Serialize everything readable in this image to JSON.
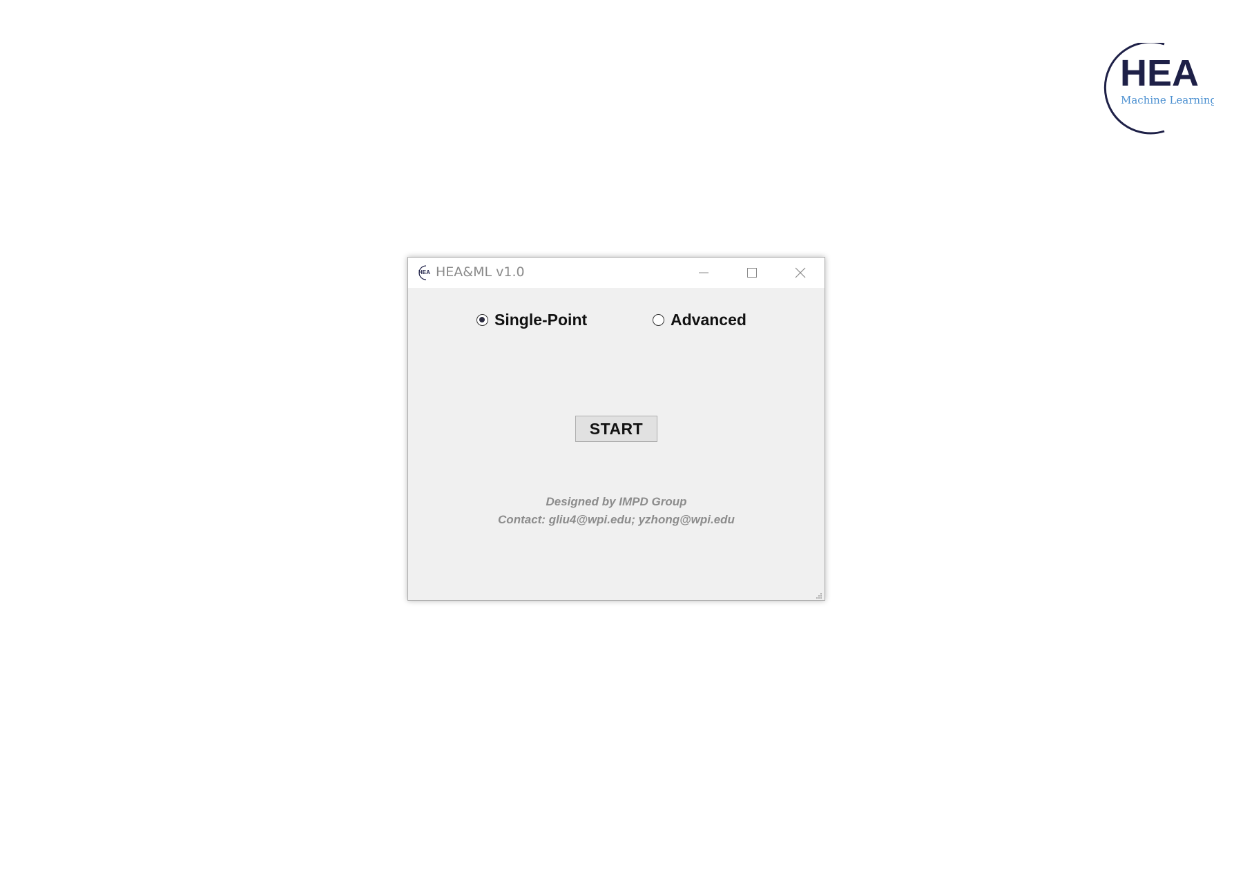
{
  "logo": {
    "title": "HEA",
    "subtitle": "Machine Learning",
    "colors": {
      "primary": "#1e2047",
      "accent": "#4a8fd0"
    }
  },
  "window": {
    "title": "HEA&ML v1.0",
    "icon": "hea-app-icon",
    "controls": {
      "minimize_icon": "minimize-icon",
      "maximize_icon": "maximize-icon",
      "close_icon": "close-icon"
    }
  },
  "mode_options": [
    {
      "label": "Single-Point",
      "checked": true
    },
    {
      "label": "Advanced",
      "checked": false
    }
  ],
  "start_button": {
    "label": "START"
  },
  "credits": {
    "line1": "Designed by IMPD Group",
    "line2": "Contact: gliu4@wpi.edu; yzhong@wpi.edu"
  }
}
